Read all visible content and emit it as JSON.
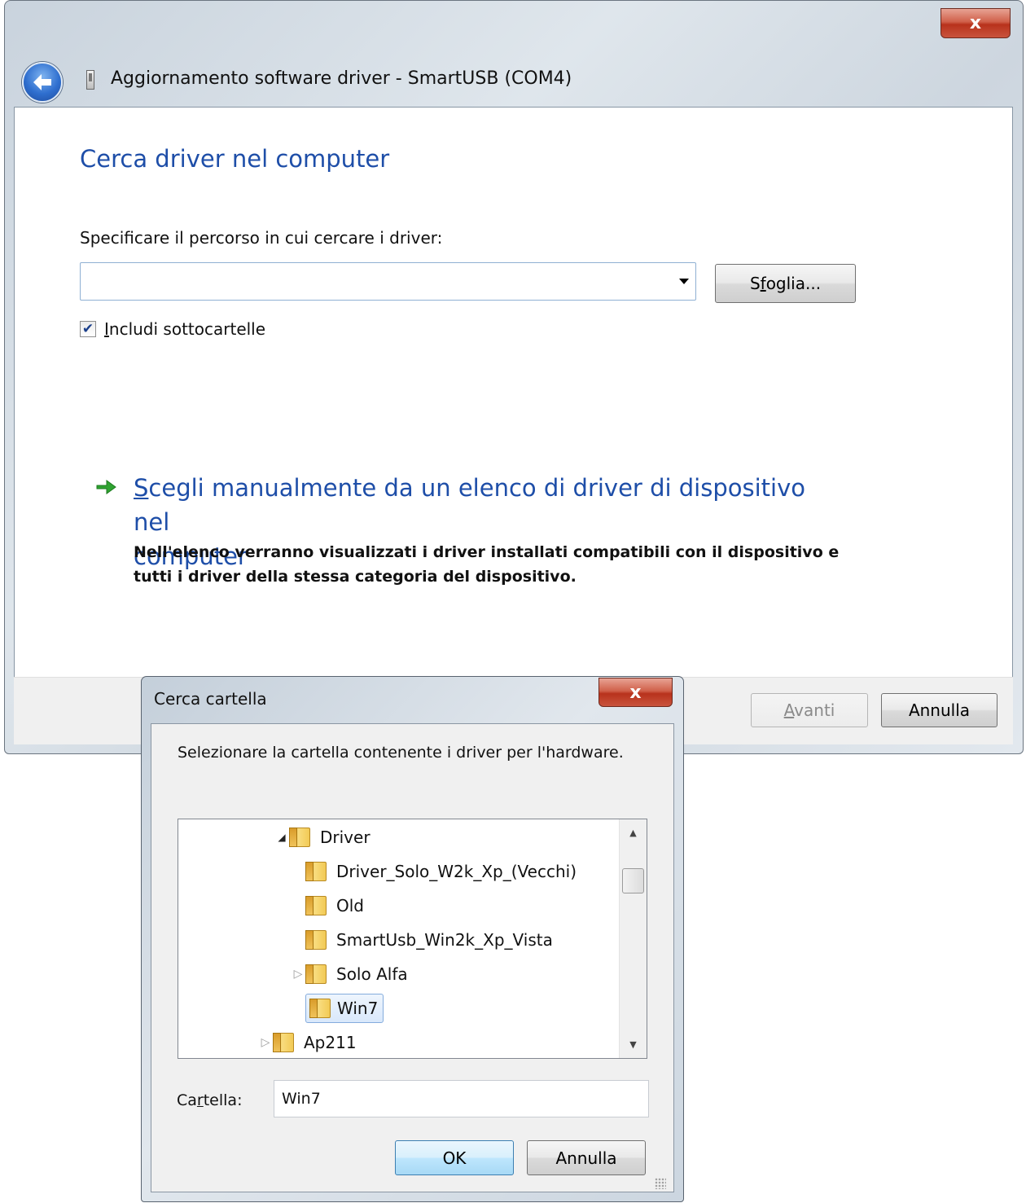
{
  "wizard": {
    "title": "Aggiornamento software driver - SmartUSB (COM4)",
    "close_glyph": "x",
    "heading": "Cerca driver nel computer",
    "path_label": "Specificare il percorso in cui cercare i driver:",
    "path_value": "",
    "browse_button": {
      "pre": "S",
      "key": "f",
      "post": "oglia..."
    },
    "include_subfolders": {
      "checked": true,
      "key": "I",
      "rest": "ncludi sottocartelle"
    },
    "manual_option": {
      "key": "S",
      "line1_rest": "cegli manualmente da un elenco di driver di dispositivo nel",
      "line2": "computer",
      "description": "Nell'elenco verranno visualizzati i driver installati compatibili con il dispositivo e tutti i driver della stessa categoria del dispositivo."
    },
    "next_button": {
      "key": "A",
      "rest": "vanti"
    },
    "cancel_button": "Annulla"
  },
  "browse_dialog": {
    "title": "Cerca cartella",
    "close_glyph": "x",
    "instruction": "Selezionare la cartella contenente i driver per l'hardware.",
    "tree": [
      {
        "label": "Driver",
        "level": 1,
        "toggle": "open",
        "selected": false
      },
      {
        "label": "Driver_Solo_W2k_Xp_(Vecchi)",
        "level": 2,
        "toggle": "none",
        "selected": false
      },
      {
        "label": "Old",
        "level": 2,
        "toggle": "none",
        "selected": false
      },
      {
        "label": "SmartUsb_Win2k_Xp_Vista",
        "level": 2,
        "toggle": "none",
        "selected": false
      },
      {
        "label": "Solo Alfa",
        "level": 2,
        "toggle": "closed",
        "selected": false
      },
      {
        "label": "Win7",
        "level": 2,
        "toggle": "none",
        "selected": true
      },
      {
        "label": "Ap211",
        "level": 0,
        "toggle": "closed",
        "selected": false
      }
    ],
    "folder_label": {
      "pre": "Ca",
      "key": "r",
      "post": "tella:"
    },
    "folder_value": "Win7",
    "ok_button": "OK",
    "cancel_button": "Annulla"
  },
  "colors": {
    "heading_blue": "#1e4ea8",
    "close_red": "#c9543d",
    "selection": "#d9e8fb"
  },
  "icons": [
    "back-arrow-icon",
    "usb-device-icon",
    "green-arrow-icon",
    "folder-icon",
    "dropdown-arrow-icon"
  ]
}
